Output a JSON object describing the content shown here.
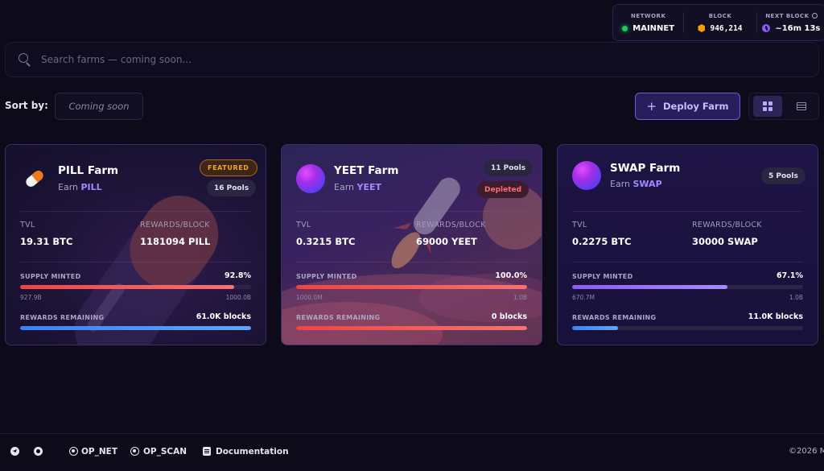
{
  "network_bar": {
    "network_label": "NETWORK",
    "network_value": "MAINNET",
    "block_label": "BLOCK",
    "block_value": "946,214",
    "next_block_label": "NEXT BLOCK",
    "next_block_value": "~16m 13s",
    "colors": {
      "network_dot": "#22c55e",
      "block_icon": "#f59e0b",
      "clock_icon": "#8b5cf6"
    }
  },
  "search": {
    "placeholder": "Search farms — coming soon..."
  },
  "toolbar": {
    "sort_label": "Sort by:",
    "sort_value": "Coming soon",
    "deploy_label": "Deploy Farm",
    "view_modes": [
      "grid",
      "list"
    ],
    "active_view": "grid"
  },
  "farms": [
    {
      "name": "PILL Farm",
      "earn_prefix": "Earn",
      "token": "PILL",
      "featured_label": "FEATURED",
      "pools": "16 Pools",
      "tvl_label": "TVL",
      "tvl": "19.31 BTC",
      "rewards_label": "REWARDS/BLOCK",
      "rewards": "1181094 PILL",
      "supply_label": "SUPPLY MINTED",
      "supply_pct": "92.8%",
      "supply_fraction": 0.928,
      "supply_min": "927.9B",
      "supply_max": "1000.0B",
      "remaining_label": "REWARDS REMAINING",
      "remaining": "61.0K blocks",
      "remaining_fraction": 1.0,
      "icon": "pill-icon"
    },
    {
      "name": "YEET Farm",
      "earn_prefix": "Earn",
      "token": "YEET",
      "pools": "11 Pools",
      "status_label": "Depleted",
      "tvl_label": "TVL",
      "tvl": "0.3215 BTC",
      "rewards_label": "REWARDS/BLOCK",
      "rewards": "69000 YEET",
      "supply_label": "SUPPLY MINTED",
      "supply_pct": "100.0%",
      "supply_fraction": 1.0,
      "supply_min": "1000.0M",
      "supply_max": "1.0B",
      "remaining_label": "REWARDS REMAINING",
      "remaining": "0 blocks",
      "remaining_fraction": 1.0,
      "icon": "token-orb-icon"
    },
    {
      "name": "SWAP Farm",
      "earn_prefix": "Earn",
      "token": "SWAP",
      "pools": "5 Pools",
      "tvl_label": "TVL",
      "tvl": "0.2275 BTC",
      "rewards_label": "REWARDS/BLOCK",
      "rewards": "30000 SWAP",
      "supply_label": "SUPPLY MINTED",
      "supply_pct": "67.1%",
      "supply_fraction": 0.671,
      "supply_min": "670.7M",
      "supply_max": "1.0B",
      "remaining_label": "REWARDS REMAINING",
      "remaining": "11.0K blocks",
      "remaining_fraction": 0.2,
      "icon": "token-orb-icon"
    }
  ],
  "footer": {
    "links": [
      "OP_NET",
      "OP_SCAN",
      "Documentation"
    ],
    "copyright": "©2026 M"
  }
}
